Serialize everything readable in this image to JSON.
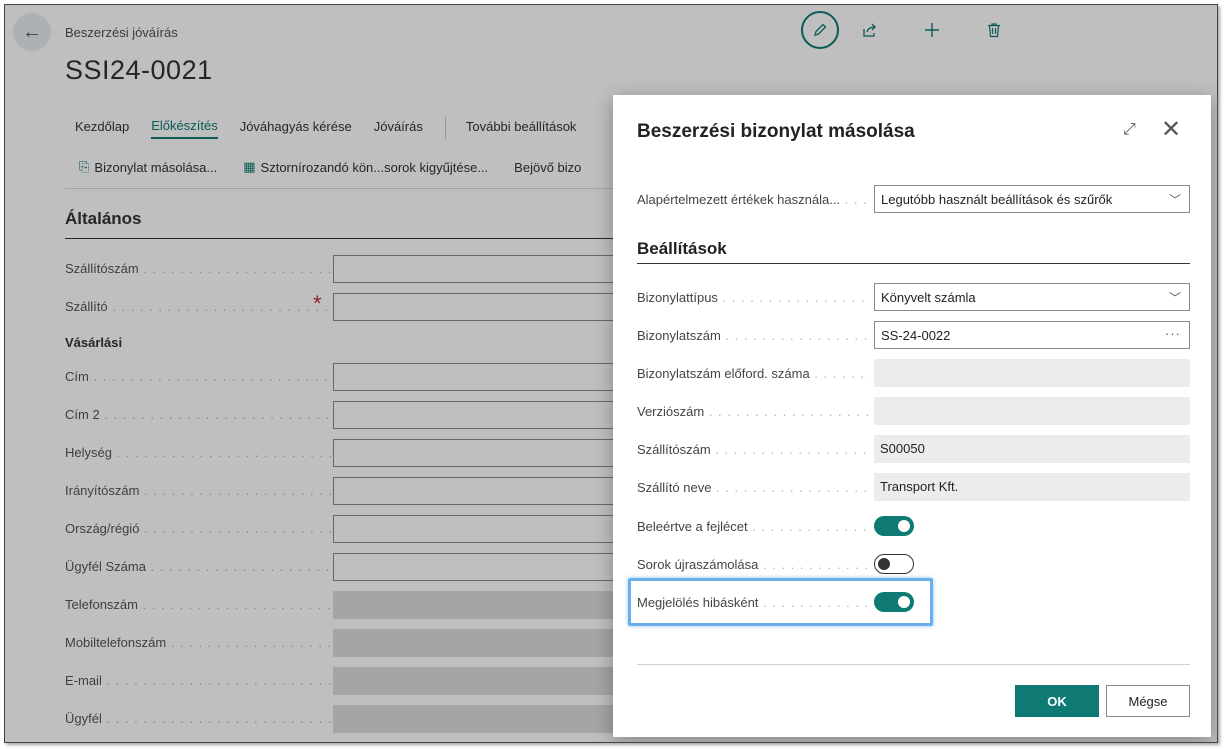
{
  "page": {
    "caption": "Beszerzési jóváírás",
    "title": "SSI24-0021",
    "tabs": [
      {
        "label": "Kezdőlap"
      },
      {
        "label": "Előkészítés"
      },
      {
        "label": "Jóváhagyás kérése"
      },
      {
        "label": "Jóváírás"
      },
      {
        "label": "További beállítások"
      }
    ],
    "subactions": [
      {
        "label": "Bizonylat másolása..."
      },
      {
        "label": "Sztornírozandó kön...sorok kigyűjtése..."
      },
      {
        "label": "Bejövő bizo"
      }
    ],
    "section": "Általános",
    "fields": {
      "vendor_no": "Szállítószám",
      "vendor": "Szállító",
      "subhead": "Vásárlási",
      "address": "Cím",
      "address2": "Cím 2",
      "city": "Helység",
      "postcode": "Irányítószám",
      "country": "Ország/régió",
      "customer_no": "Ügyfél Száma",
      "phone": "Telefonszám",
      "mobile": "Mobiltelefonszám",
      "email": "E-mail",
      "customer": "Ügyfél"
    }
  },
  "dialog": {
    "title": "Beszerzési bizonylat másolása",
    "defaults_label": "Alapértelmezett értékek használa...",
    "defaults_value": "Legutóbb használt beállítások és szűrők",
    "section": "Beállítások",
    "doc_type_label": "Bizonylattípus",
    "doc_type_value": "Könyvelt számla",
    "doc_no_label": "Bizonylatszám",
    "doc_no_value": "SS-24-0022",
    "doc_occ_label": "Bizonylatszám előford. száma",
    "version_label": "Verziószám",
    "vendor_no_label": "Szállítószám",
    "vendor_no_value": "S00050",
    "vendor_name_label": "Szállító neve",
    "vendor_name_value": "Transport Kft.",
    "include_header_label": "Beleértve a fejlécet",
    "include_header_on": true,
    "recalc_lines_label": "Sorok újraszámolása",
    "recalc_lines_on": false,
    "mark_error_label": "Megjelölés hibásként",
    "mark_error_on": true,
    "ok_label": "OK",
    "cancel_label": "Mégse"
  },
  "colors": {
    "accent": "#0f7a74",
    "required": "#c72c2c",
    "highlight": "#6aaeea"
  }
}
